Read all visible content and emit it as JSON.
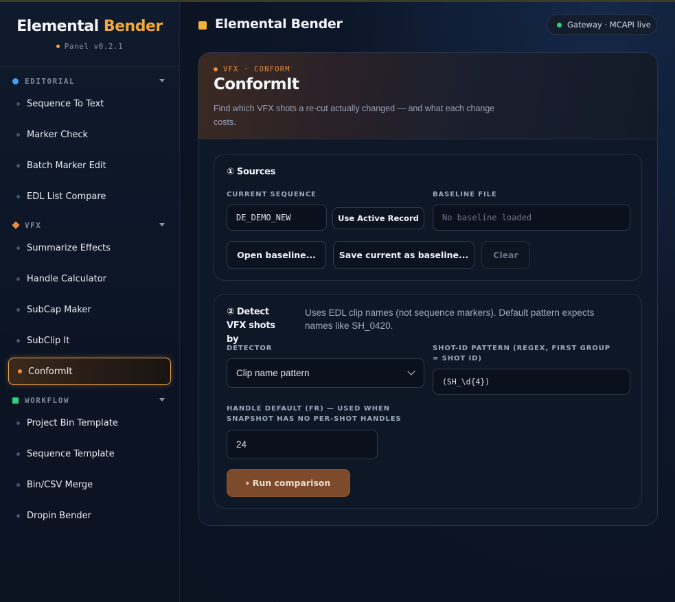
{
  "app": {
    "name_part1": "Elemental",
    "name_part2": "Bender",
    "version": "Panel v0.2.1"
  },
  "sidebar": {
    "sections": [
      {
        "label": "EDITORIAL",
        "color": "#3ea3f5",
        "items": [
          "Sequence To Text",
          "Marker Check",
          "Batch Marker Edit",
          "EDL List Compare"
        ]
      },
      {
        "label": "VFX",
        "color": "#f08a3a",
        "items": [
          "Summarize Effects",
          "Handle Calculator",
          "SubCap Maker",
          "SubClip It",
          "ConformIt"
        ]
      },
      {
        "label": "WORKFLOW",
        "color": "#2fd27a",
        "items": [
          "Project Bin Template",
          "Sequence Template",
          "Bin/CSV Merge",
          "Dropin Bender"
        ]
      }
    ],
    "active_item": "ConformIt"
  },
  "header": {
    "title": "Elemental Bender",
    "gateway_status": "Gateway · MCAPI live",
    "gateway_color": "#2fd27a"
  },
  "tool": {
    "tag": "VFX · CONFORM",
    "title": "ConformIt",
    "description": "Find which VFX shots a re-cut actually changed — and what each change costs."
  },
  "sources": {
    "title": "① Sources",
    "current_sequence_label": "CURRENT SEQUENCE",
    "current_sequence_value": "DE_DEMO_NEW",
    "use_active_record_label": "Use Active Record",
    "baseline_file_label": "BASELINE FILE",
    "baseline_placeholder": "No baseline loaded",
    "open_baseline_label": "Open baseline...",
    "save_baseline_label": "Save current as baseline...",
    "clear_label": "Clear"
  },
  "detect": {
    "title": "② Detect VFX shots by",
    "hint": "Uses EDL clip names (not sequence markers). Default pattern expects names like SH_0420.",
    "detector_label": "DETECTOR",
    "detector_value": "Clip name pattern",
    "pattern_label": "SHOT-ID PATTERN (REGEX, FIRST GROUP = SHOT ID)",
    "pattern_value": "(SH_\\d{4})",
    "handle_label": "HANDLE DEFAULT (FR) — USED WHEN SNAPSHOT HAS NO PER-SHOT HANDLES",
    "handle_value": "24",
    "run_label": "Run comparison"
  }
}
